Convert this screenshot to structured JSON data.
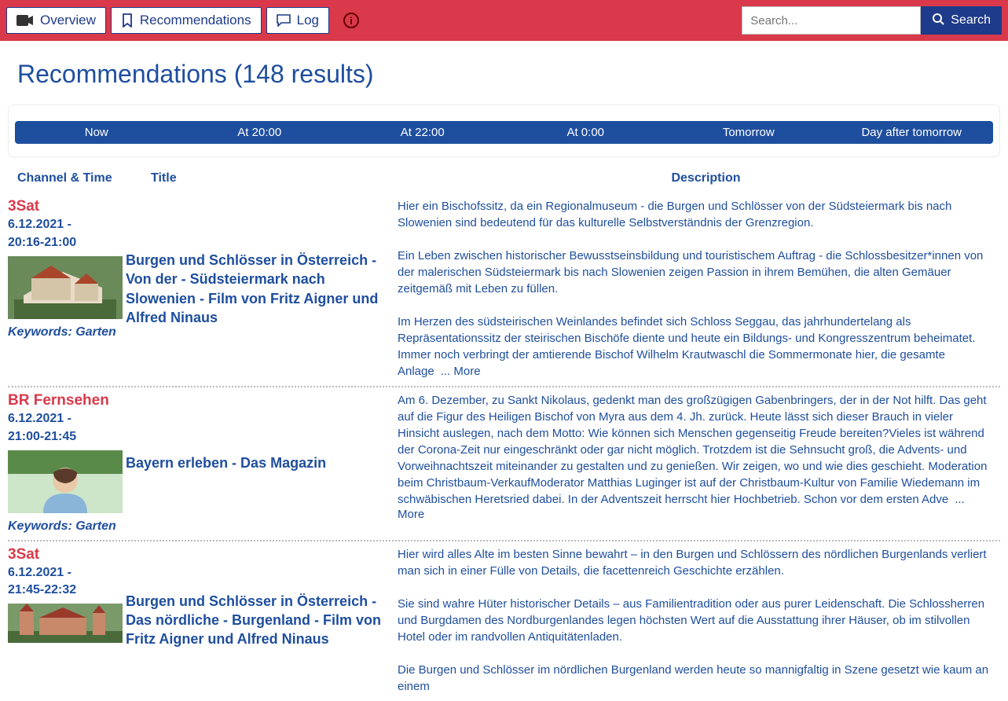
{
  "nav": {
    "overview": "Overview",
    "recommendations": "Recommendations",
    "log": "Log"
  },
  "search": {
    "placeholder": "Search...",
    "button": "Search"
  },
  "page_title": "Recommendations (148 results)",
  "time_tabs": [
    "Now",
    "At 20:00",
    "At 22:00",
    "At 0:00",
    "Tomorrow",
    "Day after tomorrow"
  ],
  "columns": {
    "channel_time": "Channel & Time",
    "title": "Title",
    "description": "Description"
  },
  "more_label": "... More",
  "rows": [
    {
      "channel": "3Sat",
      "date": "6.12.2021 -",
      "time": "20:16-21:00",
      "title": "Burgen und Schlösser in Österreich - Von der - Südsteiermark nach Slowenien - Film von Fritz Aigner und Alfred Ninaus",
      "description": "Hier ein Bischofssitz, da ein Regionalmuseum - die Burgen und Schlösser von der Südsteiermark bis nach Slowenien sind bedeutend für das kulturelle Selbstverständnis der Grenzregion.\n\nEin Leben zwischen historischer Bewusstseinsbildung und touristischem Auftrag - die Schlossbesitzer*innen von der malerischen Südsteiermark bis nach Slowenien zeigen Passion in ihrem Bemühen, die alten Gemäuer zeitgemäß mit Leben zu füllen.\n\nIm Herzen des südsteirischen Weinlandes befindet sich Schloss Seggau, das jahrhundertelang als Repräsentationssitz der steirischen Bischöfe diente und heute ein Bildungs- und Kongresszentrum beheimatet. Immer noch verbringt der amtierende Bischof Wilhelm Krautwaschl die Sommermonate hier, die gesamte Anlage",
      "keywords": "Keywords: Garten",
      "thumb_type": "castle-aerial"
    },
    {
      "channel": "BR Fernsehen",
      "date": "6.12.2021 -",
      "time": "21:00-21:45",
      "title": "Bayern erleben - Das Magazin",
      "description": "Am 6. Dezember, zu Sankt Nikolaus, gedenkt man des großzügigen Gabenbringers, der in der Not hilft. Das geht auf die Figur des Heiligen Bischof von Myra aus dem 4. Jh. zurück. Heute lässt sich dieser Brauch in vieler Hinsicht auslegen, nach dem Motto: Wie können sich Menschen gegenseitig Freude bereiten?Vieles ist während der Corona-Zeit nur eingeschränkt oder gar nicht möglich. Trotzdem ist die Sehnsucht groß, die Advents- und Vorweihnachtszeit miteinander zu gestalten und zu genießen. Wir zeigen, wo und wie dies geschieht. Moderation beim Christbaum-VerkaufModerator Matthias Luginger ist auf der Christbaum-Kultur von Familie Wiedemann im schwäbischen Heretsried dabei. In der Adventszeit herrscht hier Hochbetrieb. Schon vor dem ersten Adve",
      "keywords": "Keywords: Garten",
      "thumb_type": "presenter"
    },
    {
      "channel": "3Sat",
      "date": "6.12.2021 -",
      "time": "21:45-22:32",
      "title": "Burgen und Schlösser in Österreich - Das nördliche - Burgenland - Film von Fritz Aigner und Alfred Ninaus",
      "description": "Hier wird alles Alte im besten Sinne bewahrt – in den Burgen und Schlössern des nördlichen Burgenlands verliert man sich in einer Fülle von Details, die facettenreich Geschichte erzählen.\n\nSie sind wahre Hüter historischer Details – aus Familientradition oder aus purer Leidenschaft. Die Schlossherren und Burgdamen des Nordburgenlandes legen höchsten Wert auf die Ausstattung ihrer Häuser, ob im stilvollen Hotel oder im randvollen Antiquitätenladen.\n\nDie Burgen und Schlösser im nördlichen Burgenland werden heute so mannigfaltig in Szene gesetzt wie kaum an einem",
      "keywords": "",
      "thumb_type": "castle-red"
    }
  ]
}
